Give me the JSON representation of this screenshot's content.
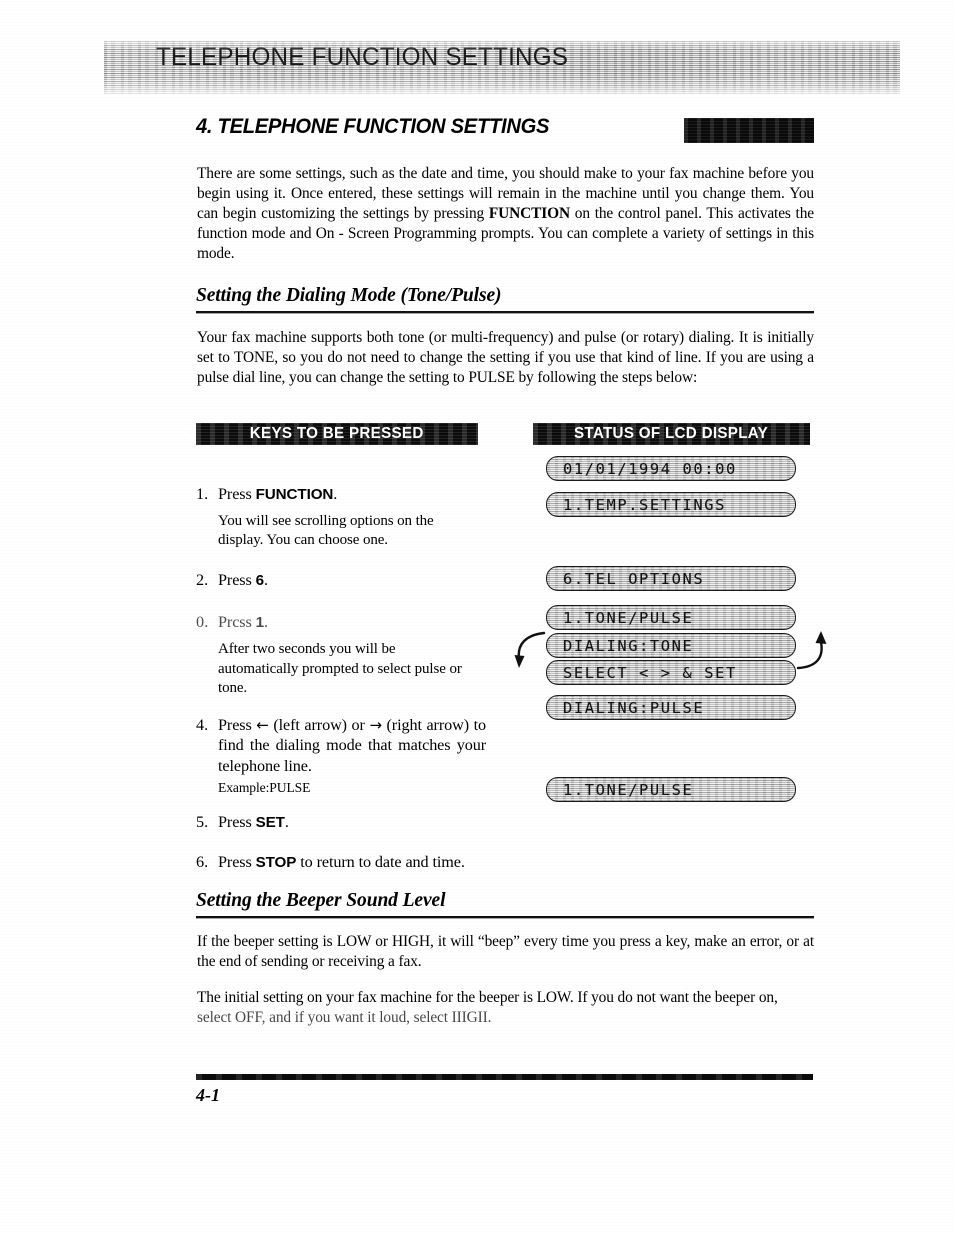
{
  "banner": {
    "running_head": "TELEPHONE FUNCTION SETTINGS"
  },
  "chapter": {
    "title": "4. TELEPHONE FUNCTION SETTINGS"
  },
  "intro": {
    "paragraph": "There are some settings, such as the date and time, you should make to your fax machine before you begin using it. Once entered, these settings will remain in the machine until you change them. You can begin customizing the settings by pressing FUNCTION on the control panel. This activates the function mode and On - Screen Programming prompts. You can complete a variety of settings in this mode.",
    "part_a": "There are some settings, such as the date and time, you should make to your fax machine before you begin using it. Once entered, these settings will remain in the machine until you change them. You can begin customizing the settings by pressing ",
    "bold_term": "FUNCTION",
    "part_b": " on the control panel. This activates the function mode and On - Screen Programming prompts. You can complete a variety of settings in this mode."
  },
  "section_dialing": {
    "heading": "Setting the Dialing Mode (Tone/Pulse)",
    "paragraph": "Your fax machine supports both tone (or multi-frequency) and pulse (or rotary) dialing. It is initially set to TONE, so you do not need to change the setting if you use that kind of line. If you are using a pulse dial line, you can change the setting to PULSE by following the steps below:"
  },
  "table": {
    "header_keys": "KEYS TO BE PRESSED",
    "header_status": "STATUS OF LCD DISPLAY"
  },
  "steps": [
    {
      "num": "1.",
      "text_before": "Press ",
      "key": "FUNCTION",
      "text_after": ".",
      "note": "You will see scrolling options on the display. You can choose one."
    },
    {
      "num": "2.",
      "text_before": "Press ",
      "key": "6",
      "text_after": ".",
      "note": ""
    },
    {
      "num": "0.",
      "text_before": "Prcss ",
      "key": "1",
      "text_after": ".",
      "note": "After two seconds you will be automatically prompted to select pulse or tone."
    },
    {
      "num": "4.",
      "text_before": "Press ",
      "key": "",
      "text_after": "",
      "body": "Press ← (left arrow) or → (right arrow) to find the dialing mode that matches your telephone line.",
      "example": "Example:PULSE"
    },
    {
      "num": "5.",
      "text_before": "Press ",
      "key": "SET",
      "text_after": ".",
      "note": ""
    },
    {
      "num": "6.",
      "text_before": "Press ",
      "key": "STOP",
      "text_after": " to return to date and time.",
      "note": ""
    }
  ],
  "step4": {
    "num": "4.",
    "lead": "Press ",
    "left_arrow": "←",
    "mid": " (left arrow) or ",
    "right_arrow": "→",
    "tail": " (right arrow) to find the dialing mode that matches your telephone line.",
    "example": "Example:PULSE"
  },
  "lcd_displays": [
    {
      "id": "lcd-datetime",
      "text": "01/01/1994 00:00"
    },
    {
      "id": "lcd-temp-settings",
      "text": "1.TEMP.SETTINGS"
    },
    {
      "id": "lcd-tel-options",
      "text": "6.TEL OPTIONS"
    },
    {
      "id": "lcd-tone-pulse-1",
      "text": "1.TONE/PULSE"
    },
    {
      "id": "lcd-dialing-tone",
      "text": "DIALING:TONE"
    },
    {
      "id": "lcd-select-set",
      "text": "SELECT < > & SET"
    },
    {
      "id": "lcd-dialing-pulse",
      "text": "DIALING:PULSE"
    },
    {
      "id": "lcd-tone-pulse-2",
      "text": "1.TONE/PULSE"
    }
  ],
  "section_beeper": {
    "heading": "Setting the Beeper Sound Level",
    "paragraph_1": "If the beeper setting is LOW or HIGH, it will “beep” every time you press a key, make an error, or at the end of sending or receiving a fax.",
    "paragraph_2_a": "The initial setting on your fax machine for the beeper is LOW. If you do not want the beeper on,",
    "paragraph_2_b": "select OFF, and if you want it loud, select IIIGII."
  },
  "footer": {
    "page_number": "4-1"
  },
  "colors": {
    "ink": "#000000",
    "paper": "#ffffff",
    "bar": "#0a0a0a",
    "lcd_face": "#d4d4d4"
  }
}
